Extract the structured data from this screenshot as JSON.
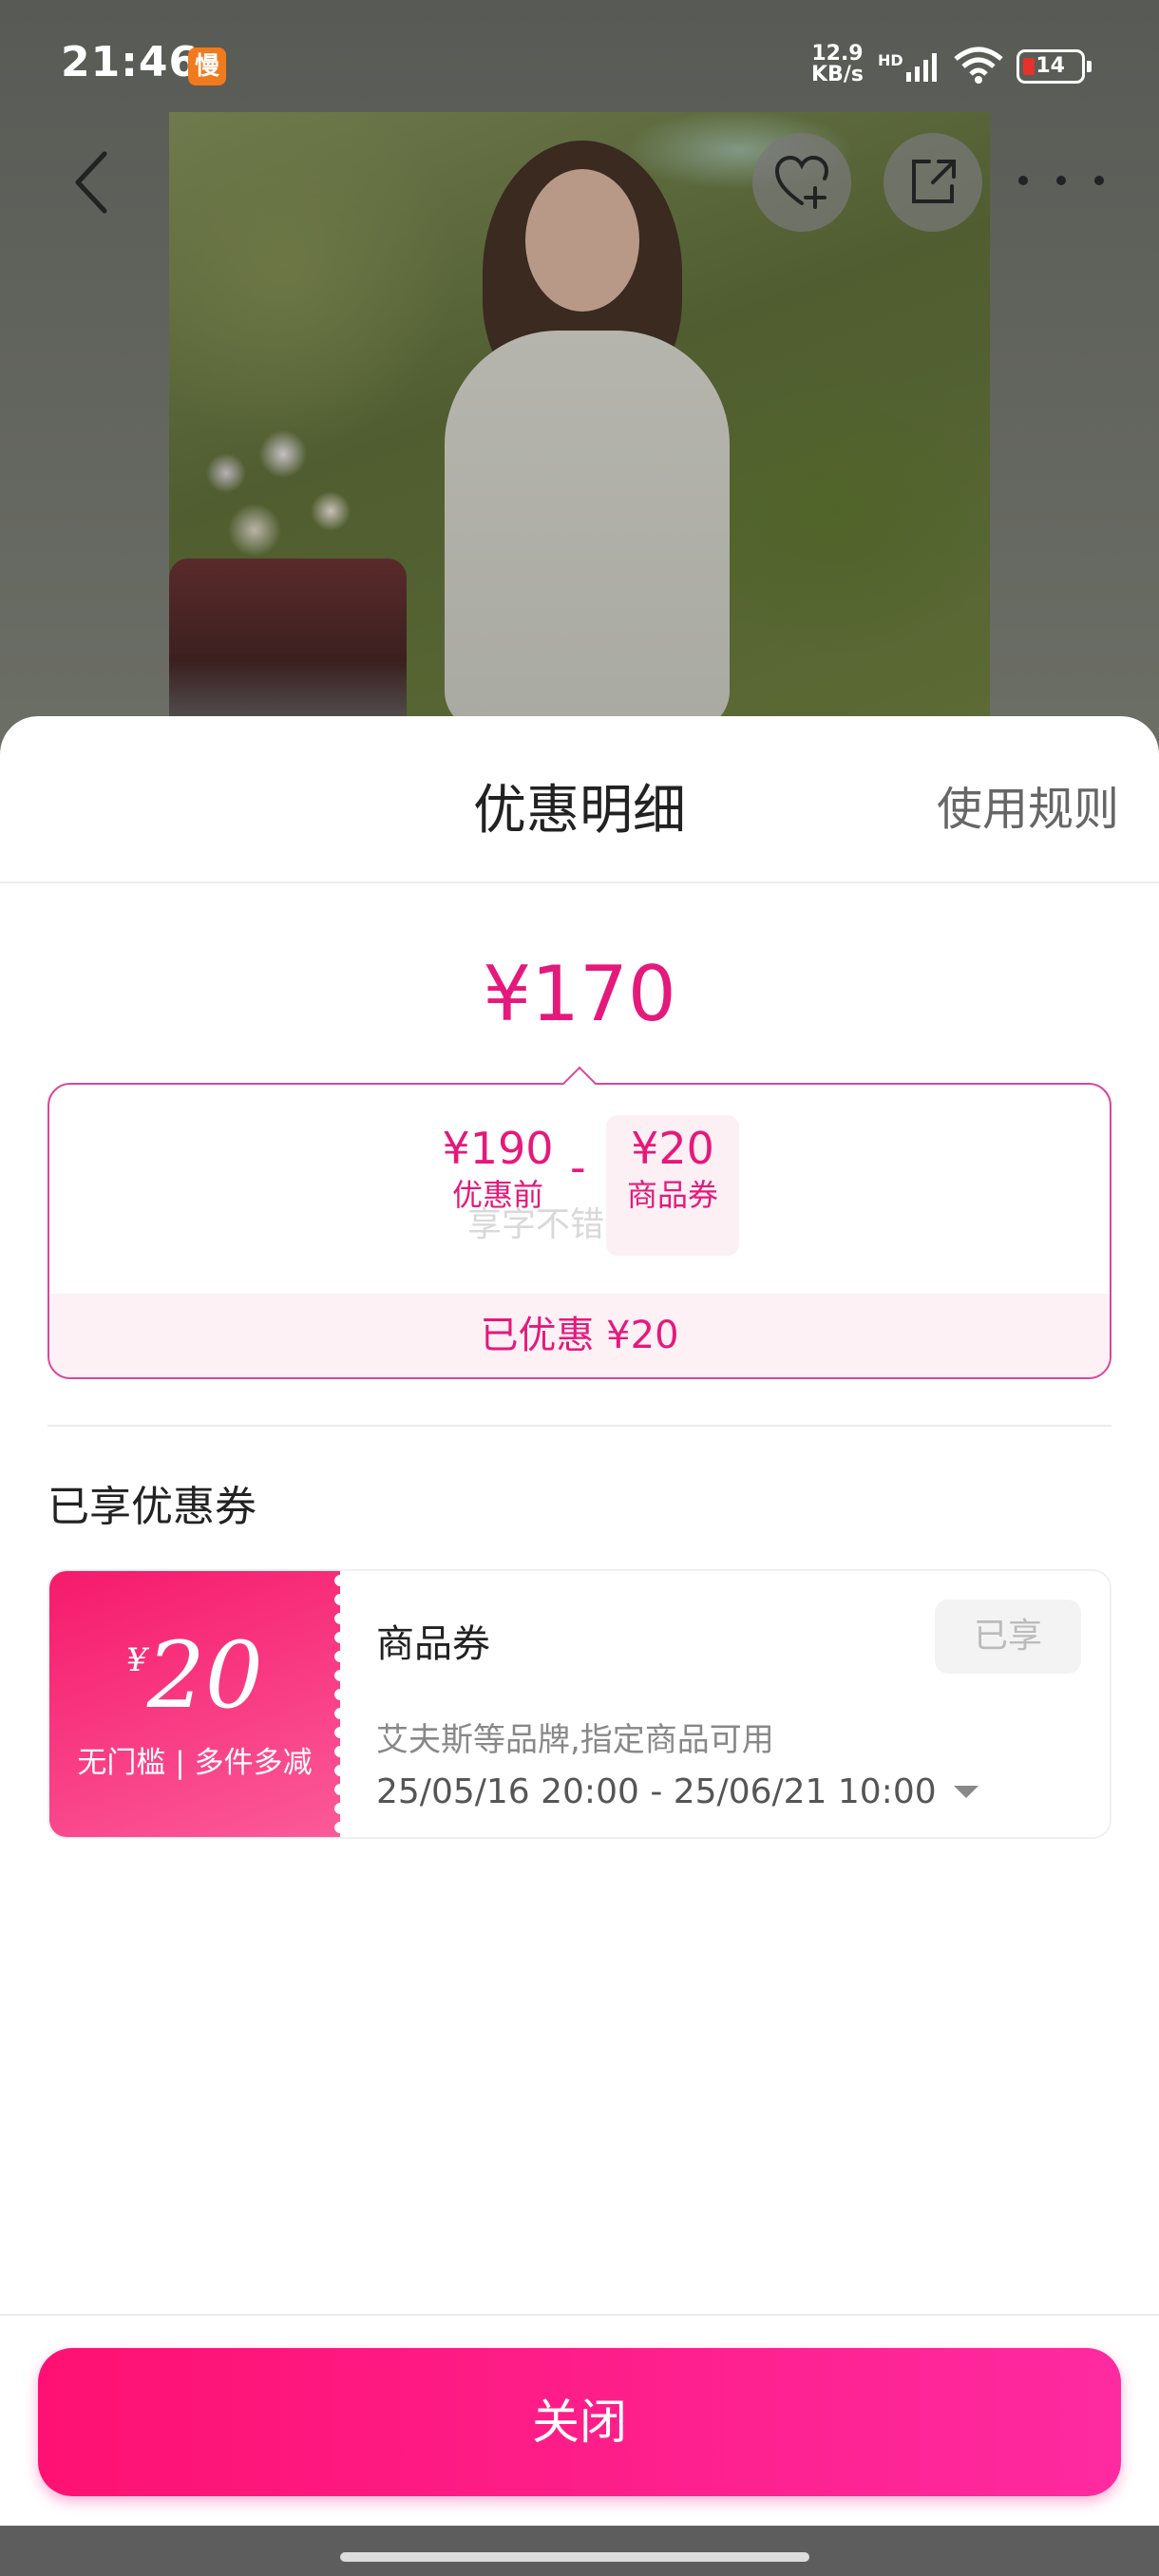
{
  "status_bar": {
    "time": "21:46",
    "app_badge": "慢",
    "speed_value": "12.9",
    "speed_unit": "KB/s",
    "network": "HD",
    "battery": "14"
  },
  "icons": {
    "back": "chevron-left-icon",
    "favorite": "heart-plus-icon",
    "share": "share-icon",
    "more": "more-dots-icon"
  },
  "sheet": {
    "title": "优惠明细",
    "rules_link": "使用规则",
    "final_price": "¥170",
    "breakdown": {
      "original_value": "¥190",
      "original_label": "优惠前",
      "minus": "-",
      "coupon_value": "¥20",
      "coupon_label": "商品券",
      "watermark": "享字不错",
      "saved": "已优惠 ¥20"
    },
    "section_title": "已享优惠券",
    "coupon": {
      "currency": "¥",
      "amount": "20",
      "condition": "无门槛 | 多件多减",
      "name": "商品券",
      "status": "已享",
      "description": "艾夫斯等品牌,指定商品可用",
      "validity": "25/05/16 20:00 - 25/06/21 10:00"
    },
    "close_button": "关闭"
  },
  "colors": {
    "accent": "#e5197b",
    "button_start": "#fe1172",
    "button_end": "#fe2aa0"
  }
}
